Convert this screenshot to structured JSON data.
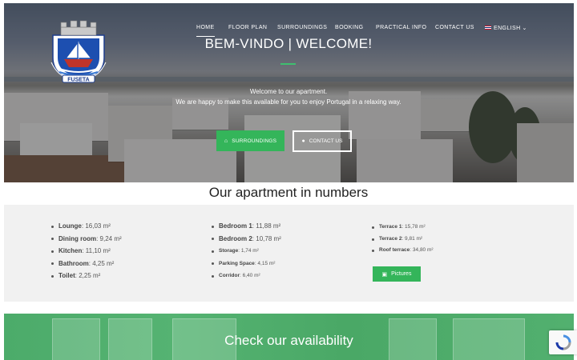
{
  "nav": {
    "items": [
      "HOME",
      "FLOOR PLAN",
      "SURROUNDINGS",
      "BOOKING",
      "PRACTICAL INFO",
      "CONTACT US"
    ],
    "language": "ENGLISH"
  },
  "logo": {
    "text": "FUSETA"
  },
  "hero": {
    "title": "BEM-VINDO | WELCOME!",
    "line1": "Welcome to our apartment.",
    "line2": "We are happy to make this available for you to enjoy Portugal in a relaxing way.",
    "btn_surroundings": "SURROUNDINGS",
    "btn_contact": "CONTACT US"
  },
  "numbers": {
    "title": "Our apartment in numbers",
    "col1": [
      {
        "name": "Lounge",
        "value": ": 16,03 m²"
      },
      {
        "name": "Dining room",
        "value": ": 9,24 m²"
      },
      {
        "name": "Kitchen",
        "value": ": 11,10 m²"
      },
      {
        "name": "Bathroom",
        "value": ": 4,25 m²"
      },
      {
        "name": "Toilet",
        "value": ": 2,25 m²"
      }
    ],
    "col2": [
      {
        "name": "Bedroom 1",
        "value": ": 11,88 m²"
      },
      {
        "name": "Bedroom 2",
        "value": ": 10,78 m²"
      },
      {
        "name": "Storage",
        "value": ": 1,74 m²"
      },
      {
        "name": "Parking Space",
        "value": ": 4,15 m²"
      },
      {
        "name": "Corridor",
        "value": ": 6,40 m²"
      }
    ],
    "col3": [
      {
        "name": "Terrace 1",
        "value": ": 15,78 m²"
      },
      {
        "name": "Terrace 2",
        "value": ": 9,81 m²"
      },
      {
        "name": "Roof terrace",
        "value": ": 34,80 m²"
      }
    ],
    "btn_pictures": "Pictures"
  },
  "availability": {
    "title": "Check our availability"
  },
  "colors": {
    "accent": "#34b55a",
    "hero_overlay": "#1e2024"
  }
}
